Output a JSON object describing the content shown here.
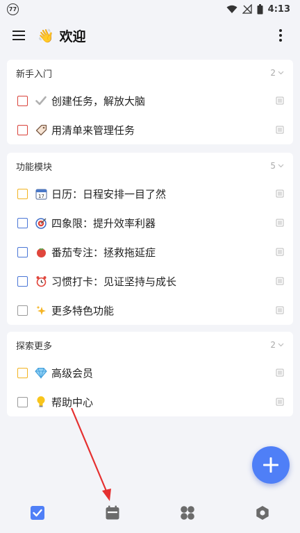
{
  "status_bar": {
    "badge": "77",
    "time": "4:13"
  },
  "header": {
    "title": "欢迎",
    "title_emoji": "👋"
  },
  "sections": [
    {
      "title": "新手入门",
      "count": "2",
      "items": [
        {
          "label": "创建任务，解放大脑",
          "emoji": "✔",
          "checkbox_color": "#d9423a"
        },
        {
          "label": "用清单来管理任务",
          "emoji": "🏷️",
          "checkbox_color": "#d9423a"
        }
      ]
    },
    {
      "title": "功能模块",
      "count": "5",
      "items": [
        {
          "label": "日历：日程安排一目了然",
          "emoji": "📅",
          "checkbox_color": "#f2b320"
        },
        {
          "label": "四象限：提升效率利器",
          "emoji": "🎯",
          "checkbox_color": "#4a76d6"
        },
        {
          "label": "番茄专注：拯救拖延症",
          "emoji": "🍅",
          "checkbox_color": "#4a76d6"
        },
        {
          "label": "习惯打卡：见证坚持与成长",
          "emoji": "⏰",
          "checkbox_color": "#4a76d6"
        },
        {
          "label": "更多特色功能",
          "emoji": "✨",
          "checkbox_color": "#9a9a9a"
        }
      ]
    },
    {
      "title": "探索更多",
      "count": "2",
      "items": [
        {
          "label": "高级会员",
          "emoji": "💎",
          "checkbox_color": "#f2b320"
        },
        {
          "label": "帮助中心",
          "emoji": "💡",
          "checkbox_color": "#9a9a9a"
        }
      ]
    }
  ],
  "bottom_nav": [
    {
      "icon": "task-check-icon",
      "active": true
    },
    {
      "icon": "calendar-icon",
      "active": false
    },
    {
      "icon": "grid-icon",
      "active": false
    },
    {
      "icon": "settings-hex-icon",
      "active": false
    }
  ],
  "colors": {
    "accent": "#4f7ff7",
    "annotation_arrow": "#e53030"
  }
}
